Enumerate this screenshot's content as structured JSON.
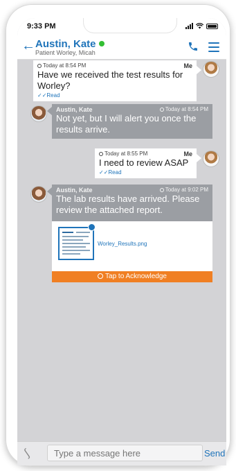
{
  "status_bar": {
    "time": "9:33 PM"
  },
  "header": {
    "back_icon": "back-arrow-icon",
    "contact_name": "Austin, Kate",
    "presence_color": "#33bf33",
    "subtitle": "Patient Worley, Micah",
    "actions": [
      "phone-icon",
      "menu-icon"
    ]
  },
  "messages": [
    {
      "direction": "outgoing",
      "sender": "Me",
      "timestamp": "Today at 8:54 PM",
      "text": "Have we received the test results for Worley?",
      "receipt": "✓✓Read"
    },
    {
      "direction": "incoming",
      "sender": "Austin, Kate",
      "timestamp": "Today at 8:54 PM",
      "text": "Not yet, but I will alert you once the results arrive."
    },
    {
      "direction": "outgoing",
      "sender": "Me",
      "timestamp": "Today at 8:55 PM",
      "text": "I need to review ASAP",
      "receipt": "✓✓Read"
    },
    {
      "direction": "incoming",
      "sender": "Austin, Kate",
      "timestamp": "Today at 9:02 PM",
      "text": "The lab results have arrived. Please review the attached report.",
      "attachment": {
        "file_name": "Worley_Results.png"
      },
      "action_label": "Tap to Acknowledge"
    }
  ],
  "composer": {
    "placeholder": "Type a message here",
    "send_label": "Send"
  },
  "colors": {
    "accent": "#1f74ba",
    "incoming_bubble": "#9b9ea3",
    "outgoing_bubble": "#ffffff",
    "acknowledge": "#f07f23",
    "chat_background": "#d3d3d6"
  }
}
